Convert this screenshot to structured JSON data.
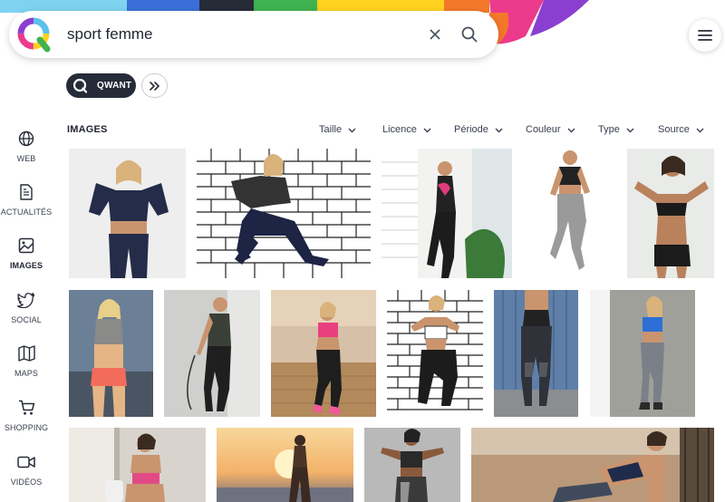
{
  "search": {
    "query": "sport femme"
  },
  "toolbar": {
    "qwant_label": "QWANT"
  },
  "nav": {
    "items": [
      {
        "label": "WEB",
        "icon": "globe-icon"
      },
      {
        "label": "ACTUALITÉS",
        "icon": "news-icon"
      },
      {
        "label": "IMAGES",
        "icon": "image-icon"
      },
      {
        "label": "SOCIAL",
        "icon": "twitter-icon"
      },
      {
        "label": "MAPS",
        "icon": "map-icon"
      },
      {
        "label": "SHOPPING",
        "icon": "cart-icon"
      },
      {
        "label": "VIDÉOS",
        "icon": "video-icon"
      }
    ],
    "active": "IMAGES"
  },
  "results": {
    "section_title": "IMAGES",
    "filters": [
      "Taille",
      "Licence",
      "Période",
      "Couleur",
      "Type",
      "Source"
    ]
  },
  "colors": {
    "accent_dark": "#262b38",
    "banner": [
      "#5bc0eb",
      "#3b6fd8",
      "#262b38",
      "#3fb34f",
      "#ffd21f",
      "#f5782a",
      "#ec3a8c",
      "#8a3fd1"
    ]
  }
}
